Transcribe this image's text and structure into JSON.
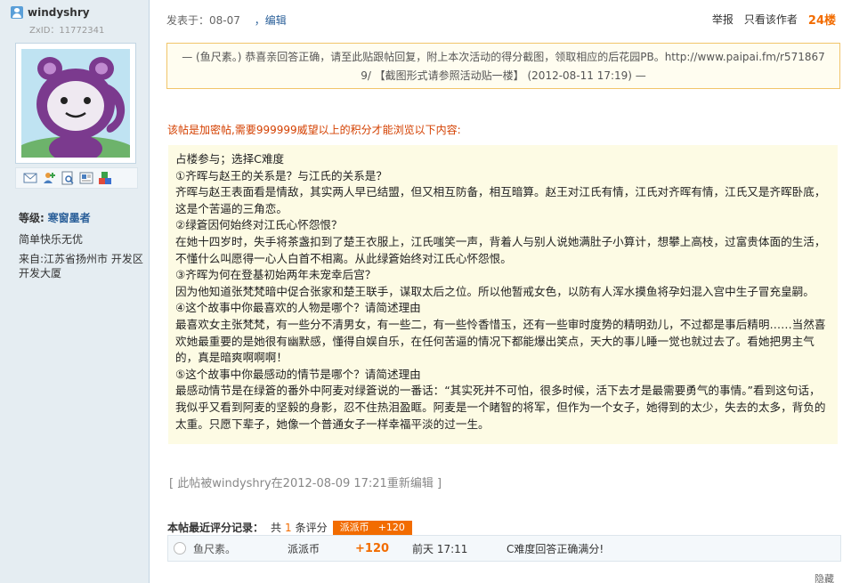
{
  "user": {
    "name": "windyshry",
    "zxid": "ZxID：11772341",
    "level_label": "等级:",
    "level_value": "寒窗墨者",
    "signature": "简单快乐无优",
    "location": "来自:江苏省扬州市 开发区开发大厦",
    "action_icons": [
      "mail-icon",
      "add-friend-icon",
      "profile-icon",
      "card-icon",
      "blocks-icon"
    ]
  },
  "post": {
    "posted": "发表于：08-07",
    "edit": "，编辑",
    "report": "举报",
    "only_author": "只看该作者",
    "floor": "24楼"
  },
  "note": {
    "line1": "— (鱼尺素。) 恭喜亲回答正确，请至此贴跟帖回复，附上本次活动的得分截图，领取相应的后花园PB。http://www.paipai.fm/r571867",
    "line2": "9/ 【截图形式请参照活动贴一楼】 (2012-08-11 17:19) —"
  },
  "locked_notice": "该帖是加密帖,需要999999威望以上的积分才能浏览以下内容:",
  "answer": [
    "占楼参与；选择C难度",
    "①齐晖与赵王的关系是？与江氏的关系是？",
    "齐晖与赵王表面看是情敌，其实两人早已结盟，但又相互防备，相互暗算。赵王对江氏有情，江氏对齐晖有情，江氏又是齐晖卧底，这是个苦逼的三角恋。",
    "②绿篬因何始终对江氏心怀怨恨？",
    "在她十四岁时，失手将茶盏扣到了楚王衣服上，江氏嗤笑一声，背着人与别人说她满肚子小算计，想攀上高枝，过富贵体面的生活，不懂什么叫愿得一心人白首不相离。从此绿篬始终对江氏心怀怨恨。",
    "③齐晖为何在登基初始两年未宠幸后宫？",
    "因为他知道张梵梵暗中促合张家和楚王联手，谋取太后之位。所以他暂戒女色，以防有人浑水摸鱼将孕妇混入宫中生子冒充皇嗣。",
    "④这个故事中你最喜欢的人物是哪个？请简述理由",
    "最喜欢女主张梵梵，有一些分不清男女，有一些二，有一些怜香惜玉，还有一些审时度势的精明劲儿，不过都是事后精明……当然喜欢她最重要的是她很有幽默感，懂得自娱自乐，在任何苦逼的情况下都能爆出笑点，天大的事儿睡一觉也就过去了。看她把男主气的，真是暗爽啊啊啊！",
    "⑤这个故事中你最感动的情节是哪个？请简述理由",
    "最感动情节是在绿篬的番外中阿麦对绿篬说的一番话：“其实死并不可怕，很多时候，活下去才是最需要勇气的事情。”看到这句话，我似乎又看到阿麦的坚毅的身影，忍不住热泪盈眶。阿麦是一个睹智的将军，但作为一个女子，她得到的太少，失去的太多，背负的太重。只愿下辈子，她像一个普通女子一样幸福平淡的过一生。"
  ],
  "edited_note": "[ 此帖被windyshry在2012-08-09 17:21重新编辑 ]",
  "rating": {
    "label": "本帖最近评分记录：",
    "prefix": "共",
    "count": "1",
    "suffix": "条评分",
    "badge_name": "派派币",
    "badge_points": "+120",
    "row": {
      "user": "鱼尺素。",
      "currency": "派派币",
      "points": "+120",
      "time": "前天  17:11",
      "reason": "C难度回答正确满分!"
    }
  },
  "hide_label": "隐藏",
  "colors": {
    "sidebar": "#e5edf2",
    "accent_orange": "#f26c00",
    "link_blue": "#2a5f99",
    "answer_bg": "#fdfbe4",
    "note_border": "#f1c56a"
  }
}
